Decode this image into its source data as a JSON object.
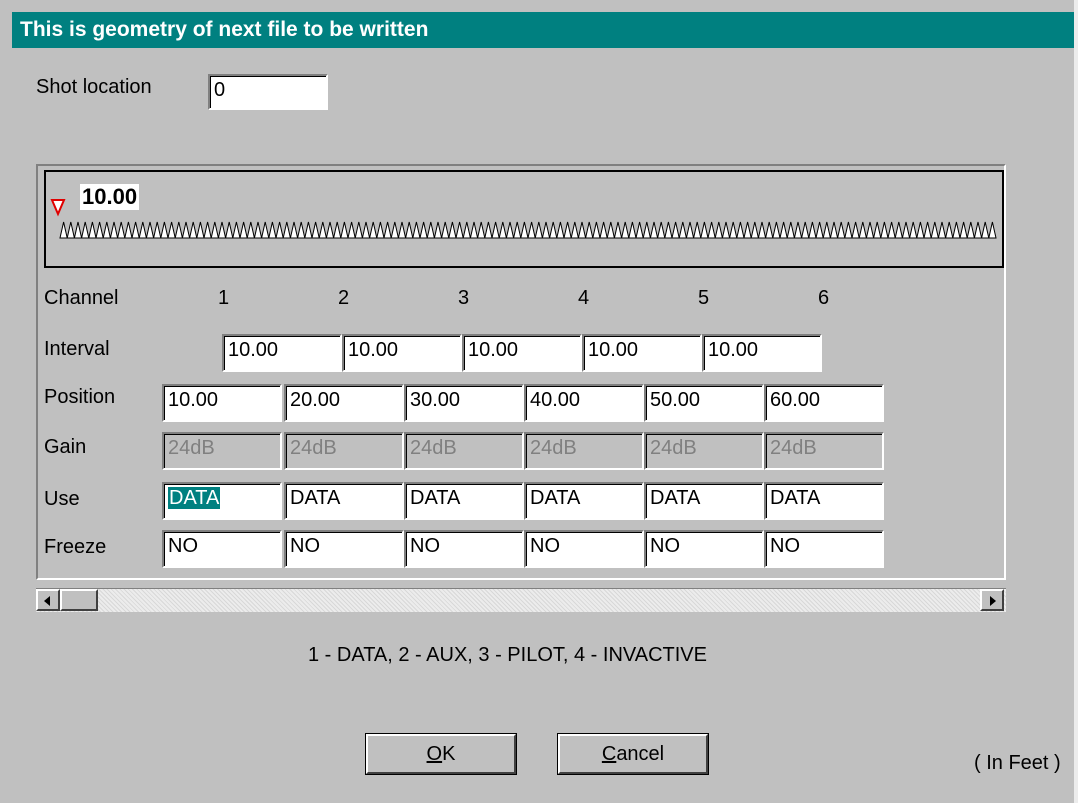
{
  "dialog": {
    "title": "This is geometry of next file to be written",
    "shot_label": "Shot location",
    "shot_value": "0",
    "geometry_display": "10.00",
    "row_labels": {
      "channel": "Channel",
      "interval": "Interval",
      "position": "Position",
      "gain": "Gain",
      "use": "Use",
      "freeze": "Freeze"
    },
    "channels": [
      "1",
      "2",
      "3",
      "4",
      "5",
      "6"
    ],
    "intervals": [
      "10.00",
      "10.00",
      "10.00",
      "10.00",
      "10.00"
    ],
    "positions": [
      "10.00",
      "20.00",
      "30.00",
      "40.00",
      "50.00",
      "60.00"
    ],
    "gains": [
      "24dB",
      "24dB",
      "24dB",
      "24dB",
      "24dB",
      "24dB"
    ],
    "uses": [
      "DATA",
      "DATA",
      "DATA",
      "DATA",
      "DATA",
      "DATA"
    ],
    "freezes": [
      "NO",
      "NO",
      "NO",
      "NO",
      "NO",
      "NO"
    ],
    "legend": "1 - DATA, 2 - AUX, 3 - PILOT, 4 - INVACTIVE",
    "ok": {
      "mnemonic": "O",
      "rest": "K"
    },
    "cancel": {
      "mnemonic": "C",
      "rest": "ancel"
    },
    "units": "( In Feet )"
  },
  "colors": {
    "titlebar": "#008080",
    "dialog_bg": "#c0c0c0",
    "selection": "#008080",
    "marker": "#e00000"
  },
  "icons": {
    "shot_marker": "red-down-triangle",
    "geophone": "white-triangle"
  }
}
